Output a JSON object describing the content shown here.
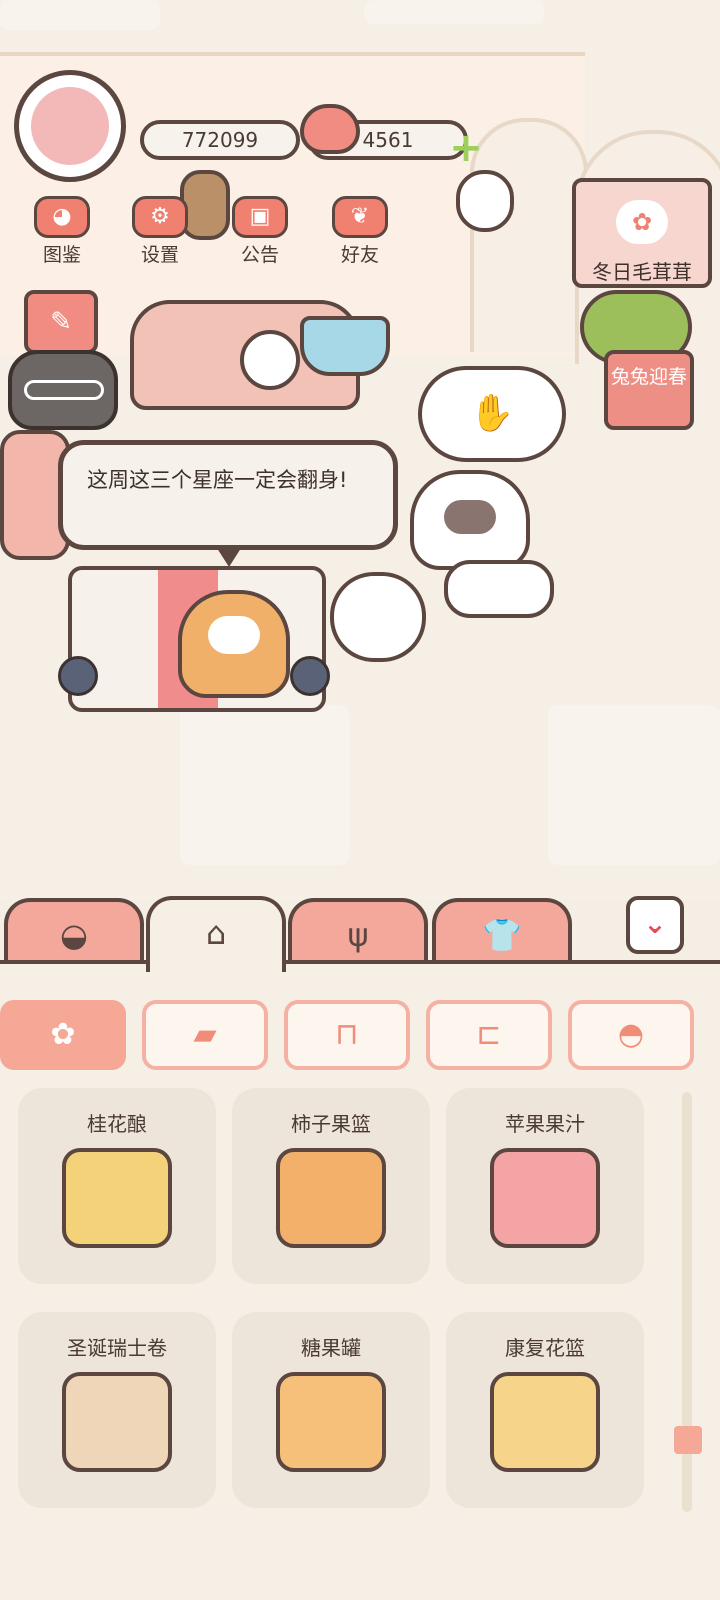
{
  "hud": {
    "coins": "772099",
    "hearts": "4561"
  },
  "menu": [
    {
      "label": "图鉴",
      "icon": "cat-face-icon"
    },
    {
      "label": "设置",
      "icon": "gear-icon"
    },
    {
      "label": "公告",
      "icon": "gift-icon"
    },
    {
      "label": "好友",
      "icon": "friends-icon"
    }
  ],
  "events": {
    "winter": "冬日毛茸茸",
    "spring": "兔兔迎春"
  },
  "speech": "这周这三个星座一定会翻身!",
  "bottom_tabs": [
    {
      "name": "chat-bubble-icon"
    },
    {
      "name": "house-icon"
    },
    {
      "name": "fork-knife-icon"
    },
    {
      "name": "shirt-icon"
    }
  ],
  "sub_tabs": [
    {
      "name": "flower-icon"
    },
    {
      "name": "paint-roller-icon"
    },
    {
      "name": "armchair-icon"
    },
    {
      "name": "bed-icon"
    },
    {
      "name": "cat-icon"
    }
  ],
  "items": [
    {
      "name": "桂花酿",
      "color": "#f3d27a"
    },
    {
      "name": "柿子果篮",
      "color": "#f3b06a"
    },
    {
      "name": "苹果果汁",
      "color": "#f4a4a4"
    },
    {
      "name": "圣诞瑞士卷",
      "color": "#f0d6b8"
    },
    {
      "name": "糖果罐",
      "color": "#f6c07a"
    },
    {
      "name": "康复花篮",
      "color": "#f6d48a"
    }
  ],
  "colors": {
    "accent": "#f4a79b",
    "outline": "#5b4640",
    "panel": "#f6efe5"
  }
}
